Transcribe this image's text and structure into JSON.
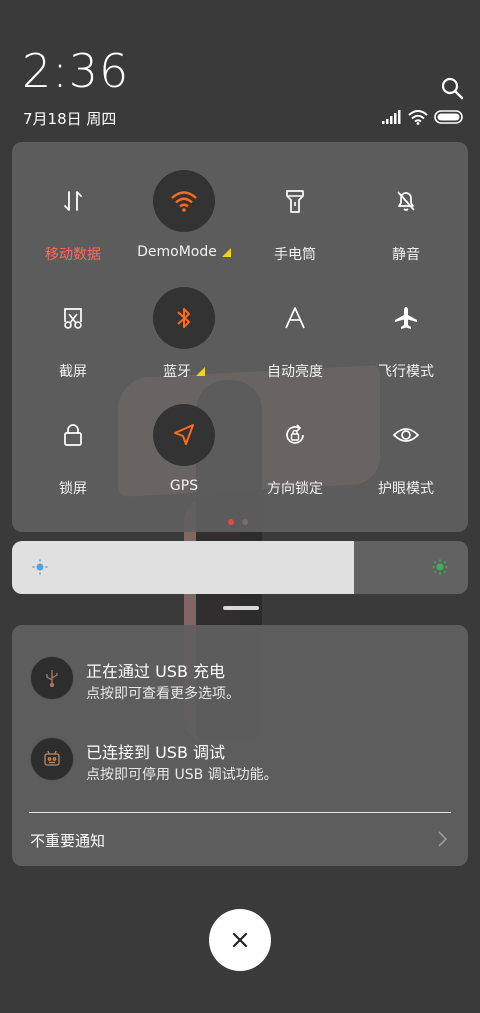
{
  "header": {
    "time": "2:36",
    "date": "7月18日 周四"
  },
  "quick_settings": {
    "tiles": [
      {
        "label": "移动数据",
        "icon": "mobile-data-icon",
        "active_label": true,
        "on": false
      },
      {
        "label": "DemoMode",
        "icon": "wifi-icon",
        "active_label": false,
        "on": true,
        "has_expand": true
      },
      {
        "label": "手电筒",
        "icon": "flashlight-icon",
        "active_label": false,
        "on": false
      },
      {
        "label": "静音",
        "icon": "bell-off-icon",
        "active_label": false,
        "on": false
      },
      {
        "label": "截屏",
        "icon": "screenshot-icon",
        "active_label": false,
        "on": false
      },
      {
        "label": "蓝牙",
        "icon": "bluetooth-icon",
        "active_label": false,
        "on": true,
        "has_expand": true
      },
      {
        "label": "自动亮度",
        "icon": "auto-brightness-icon",
        "active_label": false,
        "on": false
      },
      {
        "label": "飞行模式",
        "icon": "airplane-icon",
        "active_label": false,
        "on": false
      },
      {
        "label": "锁屏",
        "icon": "lock-icon",
        "active_label": false,
        "on": false
      },
      {
        "label": "GPS",
        "icon": "location-arrow-icon",
        "active_label": false,
        "on": true
      },
      {
        "label": "方向锁定",
        "icon": "rotation-lock-icon",
        "active_label": false,
        "on": false
      },
      {
        "label": "护眼模式",
        "icon": "eye-icon",
        "active_label": false,
        "on": false
      }
    ],
    "page_indicator": {
      "pages": 2,
      "current": 1
    }
  },
  "brightness": {
    "level": 0.75
  },
  "notifications": {
    "items": [
      {
        "title": "正在通过 USB 充电",
        "subtitle": "点按即可查看更多选项。",
        "icon": "usb-icon"
      },
      {
        "title": "已连接到 USB 调试",
        "subtitle": "点按即可停用 USB 调试功能。",
        "icon": "debug-robot-icon"
      }
    ],
    "unimportant_label": "不重要通知"
  },
  "colors": {
    "accent": "#ff6b1a",
    "active_label": "#ff6b5b",
    "panel": "#5f5f5f",
    "background": "#3a3a3a",
    "warning_triangle": "#f2d21a"
  }
}
